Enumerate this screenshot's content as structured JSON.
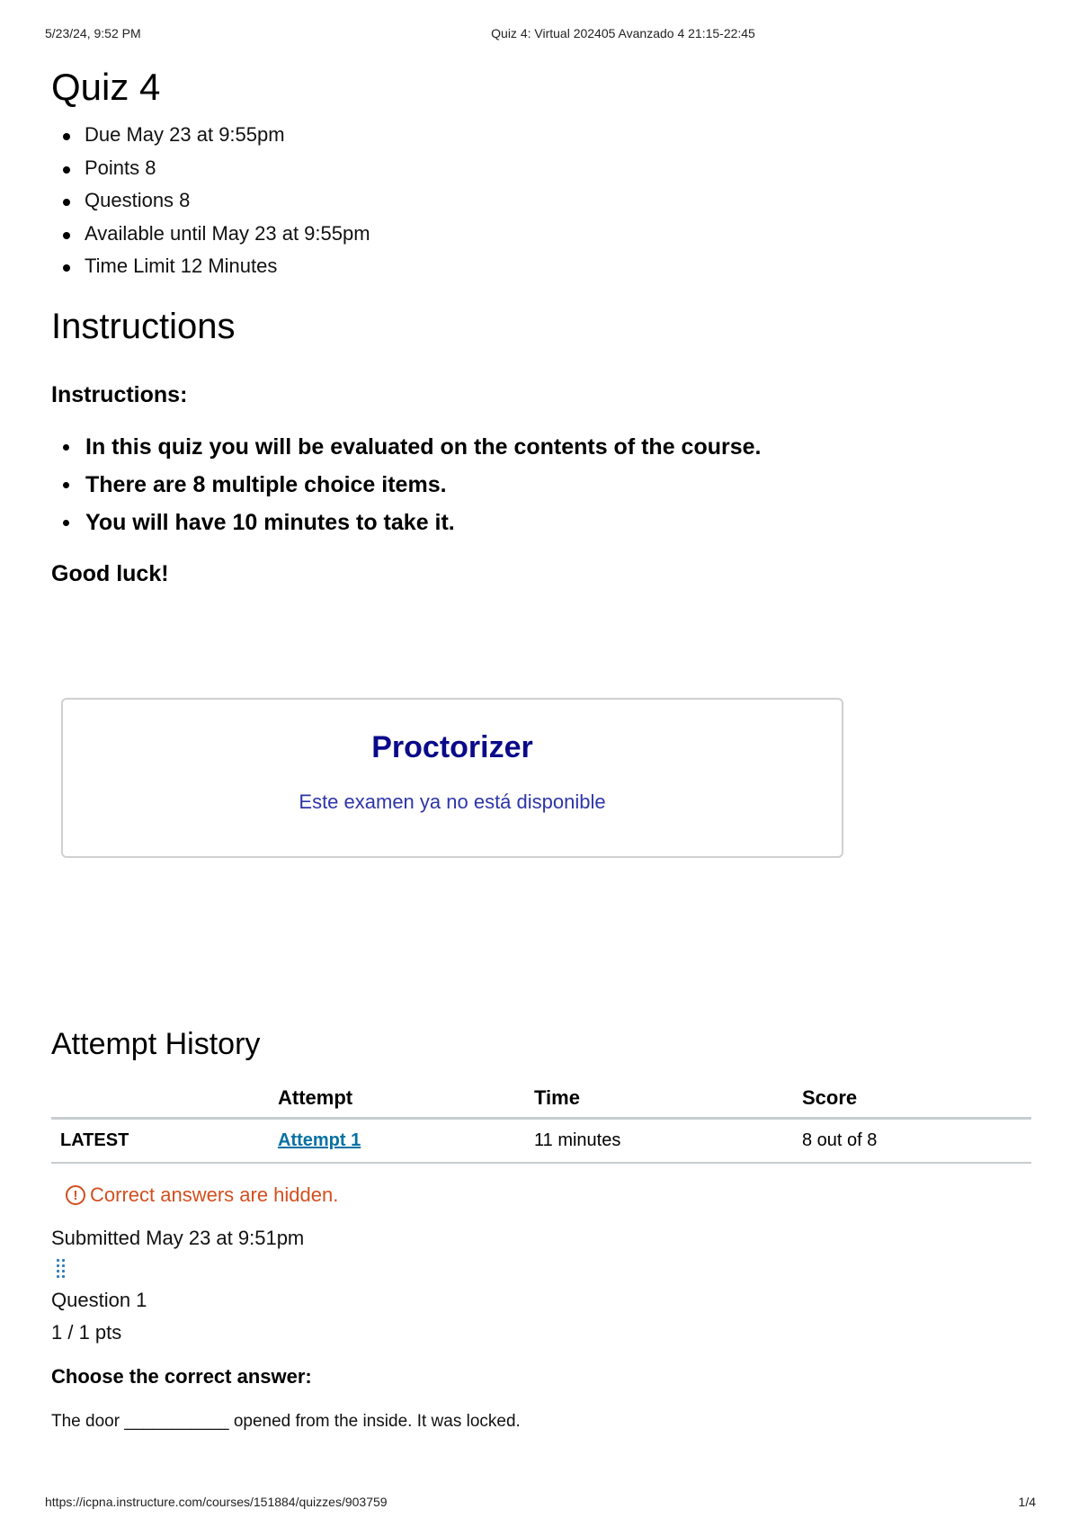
{
  "print": {
    "date": "5/23/24, 9:52 PM",
    "doc_title": "Quiz 4: Virtual 202405 Avanzado 4 21:15-22:45",
    "url": "https://icpna.instructure.com/courses/151884/quizzes/903759",
    "page": "1/4"
  },
  "quiz": {
    "title": "Quiz 4",
    "meta": [
      "Due May 23 at 9:55pm",
      "Points 8",
      "Questions 8",
      "Available until May 23 at 9:55pm",
      "Time Limit 12 Minutes"
    ]
  },
  "instructions": {
    "heading": "Instructions",
    "label": "Instructions:",
    "items": [
      "In this quiz you will be evaluated on the contents of the course.",
      "There are 8 multiple choice items.",
      "You will have 10 minutes to take it."
    ],
    "closing": "Good luck!"
  },
  "proctorizer": {
    "title": "Proctorizer",
    "message": "Este examen ya no está disponible"
  },
  "attempt_history": {
    "heading": "Attempt History",
    "columns": [
      "",
      "Attempt",
      "Time",
      "Score"
    ],
    "rows": [
      {
        "label": "LATEST",
        "attempt": "Attempt 1",
        "time": "11 minutes",
        "score": "8 out of 8"
      }
    ]
  },
  "results": {
    "hidden_note": "Correct answers are hidden.",
    "submitted": "Submitted May 23 at 9:51pm"
  },
  "question": {
    "label": "Question 1",
    "points": "1 / 1 pts",
    "prompt": "Choose the correct answer:",
    "sentence": "The door ___________ opened from the inside. It was locked."
  },
  "colors": {
    "proctor_title": "#0a0a8a",
    "proctor_message": "#2e35a8",
    "link": "#0770a3",
    "warning": "#d24f1f"
  }
}
